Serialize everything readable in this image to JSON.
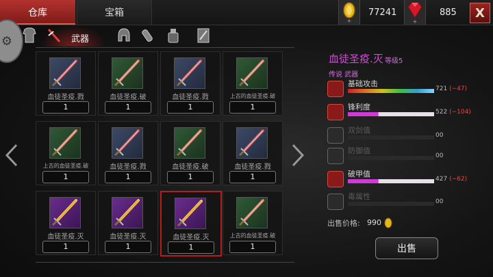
{
  "tabs": [
    {
      "label": "仓库"
    },
    {
      "label": "宝箱"
    }
  ],
  "currency": {
    "coins": "77241",
    "gems": "885"
  },
  "close_label": "X",
  "category_label": "武器",
  "items": [
    {
      "name": "血徒圣疫.戮",
      "qty": "1",
      "rarity": "blue"
    },
    {
      "name": "血徒圣疫.破",
      "qty": "1",
      "rarity": "green"
    },
    {
      "name": "血徒圣疫.戮",
      "qty": "1",
      "rarity": "blue"
    },
    {
      "name": "上古的血徒圣疫.破",
      "qty": "1",
      "rarity": "green"
    },
    {
      "name": "上古的血徒圣疫.破",
      "qty": "1",
      "rarity": "green"
    },
    {
      "name": "血徒圣疫.戮",
      "qty": "1",
      "rarity": "blue"
    },
    {
      "name": "血徒圣疫.破",
      "qty": "1",
      "rarity": "green"
    },
    {
      "name": "血徒圣疫.戮",
      "qty": "1",
      "rarity": "blue"
    },
    {
      "name": "血徒圣疫.灭",
      "qty": "1",
      "rarity": "purple"
    },
    {
      "name": "血徒圣疫.灭",
      "qty": "1",
      "rarity": "purple"
    },
    {
      "name": "血徒圣疫.灭",
      "qty": "1",
      "rarity": "purple"
    },
    {
      "name": "上古的血徒圣疫.破",
      "qty": "1",
      "rarity": "green"
    }
  ],
  "selected_index": 10,
  "detail": {
    "title": "血徒圣疫.灭",
    "level": "等级5",
    "rarity": "传说 武器",
    "stats": [
      {
        "label": "基础攻击",
        "value": "721",
        "delta": "(−47)",
        "fill": 1.0,
        "style": "rainbow",
        "active": true
      },
      {
        "label": "锋利度",
        "value": "522",
        "delta": "(−104)",
        "fill": 1.0,
        "style": "pink",
        "active": true
      },
      {
        "label": "双剑值",
        "value": "00",
        "delta": "",
        "fill": 0,
        "style": "none",
        "active": false
      },
      {
        "label": "防御值",
        "value": "00",
        "delta": "",
        "fill": 0,
        "style": "none",
        "active": false
      },
      {
        "label": "破甲值",
        "value": "427",
        "delta": "(−62)",
        "fill": 1.0,
        "style": "pink",
        "active": true
      },
      {
        "label": "毒属性",
        "value": "00",
        "delta": "",
        "fill": 0,
        "style": "none",
        "active": false
      }
    ]
  },
  "price_label": "出售价格:",
  "price_value": "990",
  "sell_label": "出售",
  "colors": {
    "accent": "#b2322e",
    "title": "#d24bd8",
    "negative": "#ee4444"
  }
}
